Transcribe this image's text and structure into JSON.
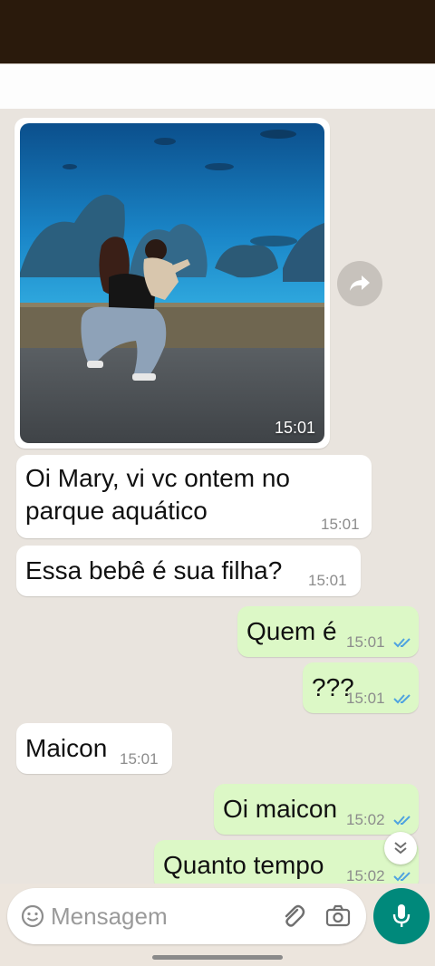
{
  "chat": {
    "photo_message": {
      "time": "15:01"
    },
    "messages": [
      {
        "direction": "in",
        "text": "Oi Mary, vi vc ontem no parque aquático",
        "time": "15:01"
      },
      {
        "direction": "in",
        "text": "Essa bebê é sua filha?",
        "time": "15:01"
      },
      {
        "direction": "out",
        "text": "Quem é",
        "time": "15:01",
        "status": "read"
      },
      {
        "direction": "out",
        "text": "???",
        "time": "15:01",
        "status": "read"
      },
      {
        "direction": "in",
        "text": "Maicon",
        "time": "15:01"
      },
      {
        "direction": "out",
        "text": "Oi maicon",
        "time": "15:02",
        "status": "read"
      },
      {
        "direction": "out",
        "text": "Quanto tempo",
        "time": "15:02",
        "status": "read"
      }
    ]
  },
  "composer": {
    "placeholder": "Mensagem",
    "icons": [
      "emoji-icon",
      "attach-icon",
      "camera-icon",
      "mic-icon"
    ]
  },
  "floating": {
    "icons": [
      "forward-icon",
      "scroll-down-icon"
    ]
  },
  "colors": {
    "status_bar": "#2a1a0c",
    "chat_background": "#e9e4de",
    "incoming_bubble": "#ffffff",
    "outgoing_bubble": "#dcf8c6",
    "read_ticks": "#4fa3e0",
    "mic_button": "#00897b"
  }
}
